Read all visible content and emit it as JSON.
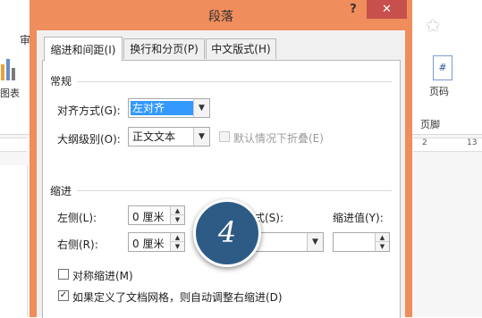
{
  "background": {
    "ribbon_tab": "审",
    "left_label": "图表",
    "right_icon": "#",
    "right_label_1": "页码",
    "right_label_2": "页脚",
    "ruler_marks": [
      "2",
      "13"
    ]
  },
  "dialog": {
    "title": "段落",
    "help": "?",
    "close": "✕",
    "tabs": [
      {
        "label": "缩进和间距(I)",
        "active": true
      },
      {
        "label": "换行和分页(P)",
        "active": false
      },
      {
        "label": "中文版式(H)",
        "active": false
      }
    ],
    "general": {
      "title": "常规",
      "alignment_label": "对齐方式(G):",
      "alignment_value": "左对齐",
      "outline_label": "大纲级别(O):",
      "outline_value": "正文文本",
      "collapse_label": "默认情况下折叠(E)"
    },
    "indent": {
      "title": "缩进",
      "left_label": "左侧(L):",
      "left_value": "0 厘米",
      "right_label": "右侧(R):",
      "right_value": "0 厘米",
      "special_label": "式(S):",
      "special_value": "",
      "by_label": "缩进值(Y):",
      "by_value": "",
      "mirror_label": "对称缩进(M)",
      "mirror_checked": false,
      "auto_adjust_label": "如果定义了文档网格，则自动调整右缩进(D)",
      "auto_adjust_checked": true
    }
  },
  "step_badge": "4"
}
